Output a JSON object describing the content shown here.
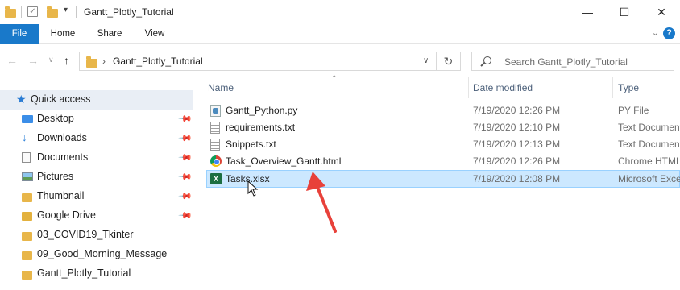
{
  "window": {
    "title": "Gantt_Plotly_Tutorial",
    "minimize": "—",
    "maximize": "☐",
    "close": "✕"
  },
  "ribbon": {
    "tabs": [
      "File",
      "Home",
      "Share",
      "View"
    ],
    "expand": "⌄",
    "help": "?"
  },
  "address": {
    "path_separator": "›",
    "path": "Gantt_Plotly_Tutorial",
    "search_placeholder": "Search Gantt_Plotly_Tutorial"
  },
  "nav_pane": {
    "items": [
      {
        "label": "Quick access",
        "icon": "star-icon",
        "pinned": false
      },
      {
        "label": "Desktop",
        "icon": "desktop-icon",
        "pinned": true
      },
      {
        "label": "Downloads",
        "icon": "download-icon",
        "pinned": true
      },
      {
        "label": "Documents",
        "icon": "documents-icon",
        "pinned": true
      },
      {
        "label": "Pictures",
        "icon": "pictures-icon",
        "pinned": true
      },
      {
        "label": "Thumbnail",
        "icon": "folder-icon",
        "pinned": true
      },
      {
        "label": "Google Drive",
        "icon": "google-drive-icon",
        "pinned": true
      },
      {
        "label": "03_COVID19_Tkinter",
        "icon": "folder-icon",
        "pinned": false
      },
      {
        "label": "09_Good_Morning_Message",
        "icon": "folder-icon",
        "pinned": false
      },
      {
        "label": "Gantt_Plotly_Tutorial",
        "icon": "folder-icon",
        "pinned": false
      }
    ]
  },
  "columns": {
    "name": "Name",
    "date_modified": "Date modified",
    "type": "Type"
  },
  "files": [
    {
      "name": "Gantt_Python.py",
      "date": "7/19/2020 12:26 PM",
      "type": "PY File",
      "icon": "python-file-icon"
    },
    {
      "name": "requirements.txt",
      "date": "7/19/2020 12:10 PM",
      "type": "Text Document",
      "icon": "text-file-icon"
    },
    {
      "name": "Snippets.txt",
      "date": "7/19/2020 12:13 PM",
      "type": "Text Document",
      "icon": "text-file-icon"
    },
    {
      "name": "Task_Overview_Gantt.html",
      "date": "7/19/2020 12:26 PM",
      "type": "Chrome HTML",
      "icon": "chrome-html-icon"
    },
    {
      "name": "Tasks.xlsx",
      "date": "7/19/2020 12:08 PM",
      "type": "Microsoft Excel",
      "icon": "excel-file-icon",
      "selected": true
    }
  ],
  "colors": {
    "accent": "#1979ca",
    "selection": "#cce8ff",
    "annotation_arrow": "#e8413a"
  }
}
